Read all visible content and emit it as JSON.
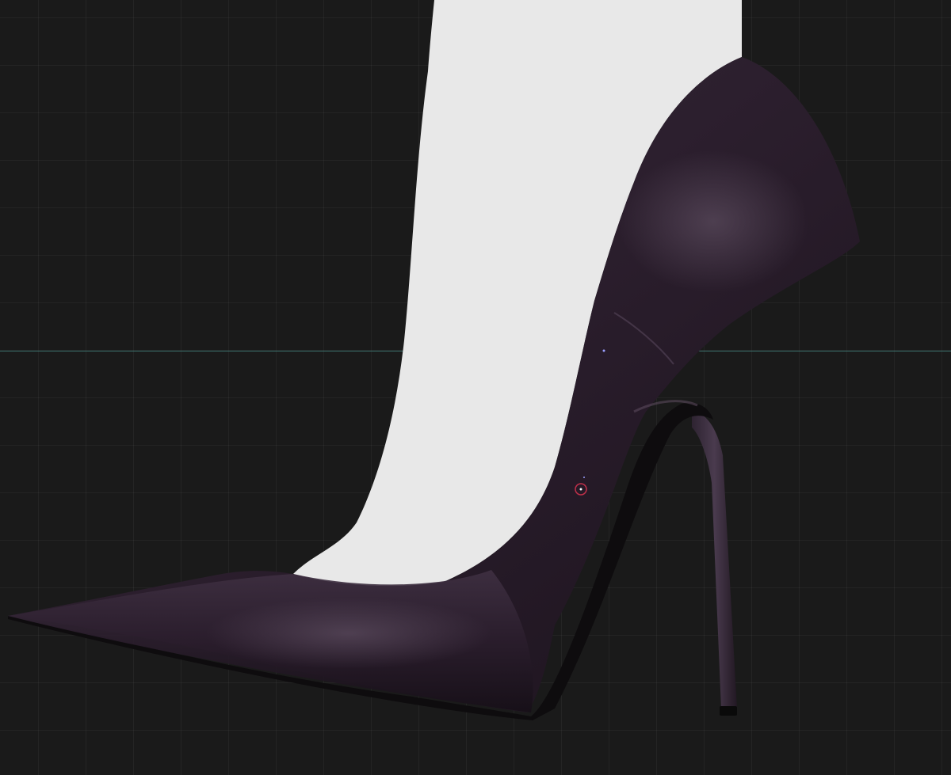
{
  "app": {
    "view": "3D viewport",
    "grid": true,
    "background_color": "#1a1a1a",
    "grid_line_color": "#2a2a2a",
    "axis_line_color": "#3f7d78"
  },
  "scene": {
    "model_name_icon": "high-heel-pump-model",
    "leg_color": "#e8e8e8",
    "shoe_color": "#2a1d2c",
    "sole_color": "#0e0c0e",
    "pivot_marker_color": "#c0304a"
  }
}
